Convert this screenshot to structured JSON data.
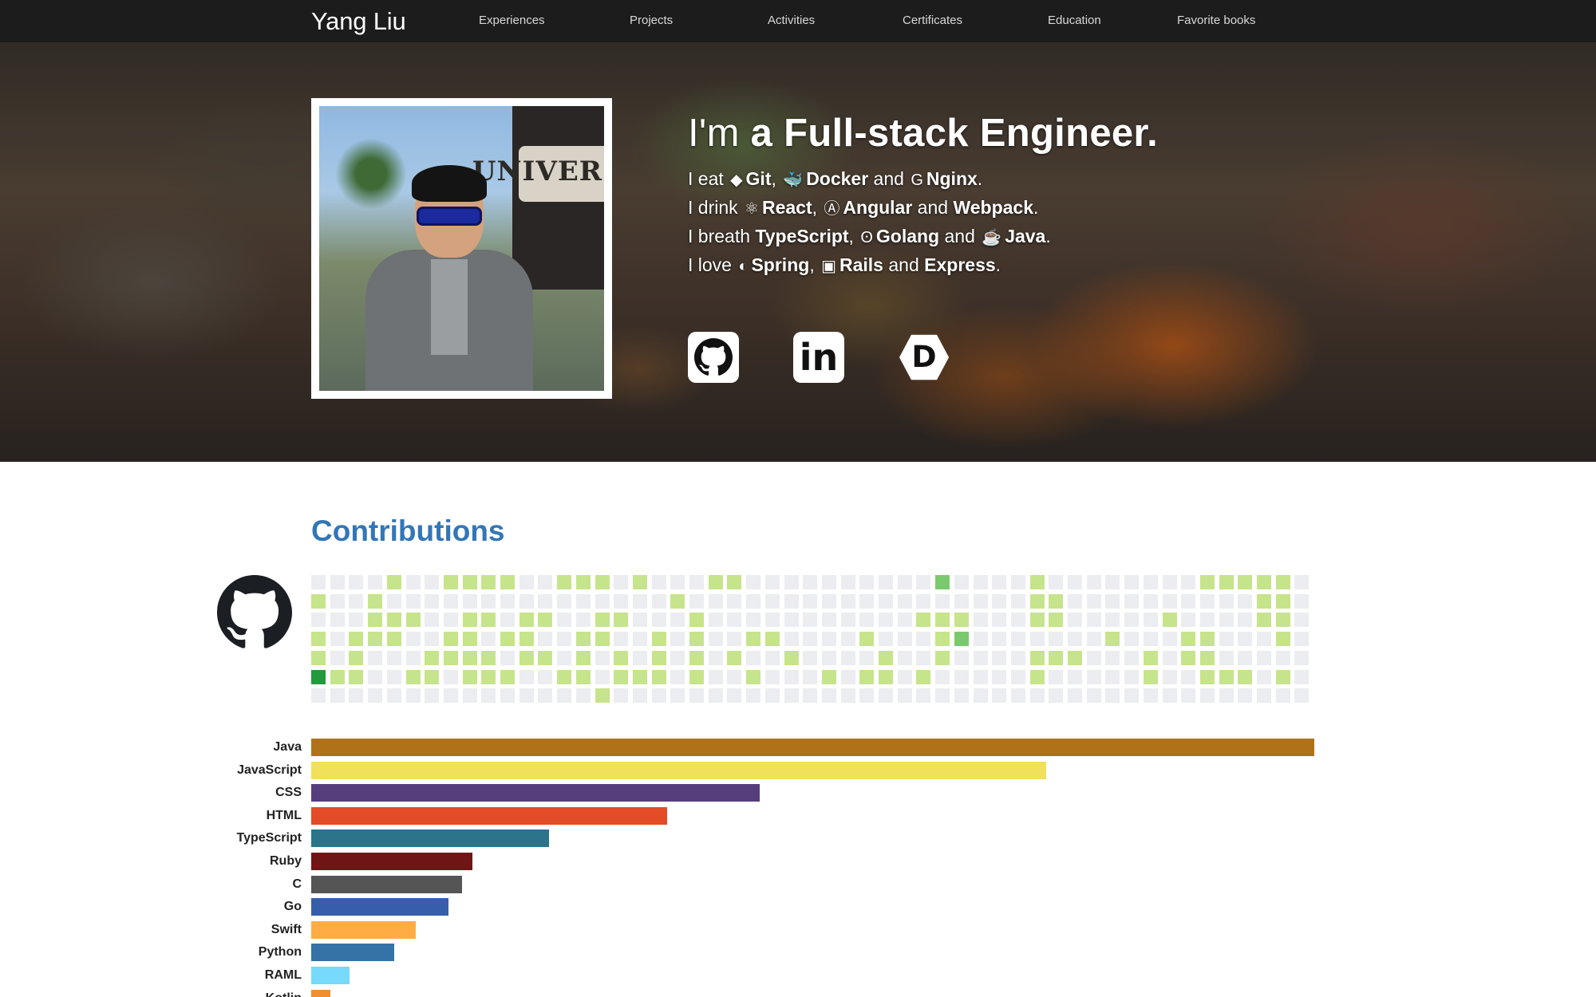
{
  "navbar": {
    "brand": "Yang Liu",
    "links": [
      {
        "label": "Experiences",
        "active": true
      },
      {
        "label": "Projects",
        "active": false
      },
      {
        "label": "Activities",
        "active": false
      },
      {
        "label": "Certificates",
        "active": false
      },
      {
        "label": "Education",
        "active": false
      },
      {
        "label": "Favorite books",
        "active": false
      }
    ]
  },
  "hero": {
    "title_prefix": "I'm",
    "title_a": "a",
    "title_main": "Full-stack Engineer.",
    "lines": [
      {
        "verb": "I eat",
        "items": [
          {
            "icon": "git-icon",
            "glyph": "◆",
            "name": "Git",
            "sep": ","
          },
          {
            "icon": "docker-icon",
            "glyph": "🐳",
            "name": "Docker",
            "sep": " and"
          },
          {
            "icon": "nginx-icon",
            "glyph": "G",
            "name": "Nginx",
            "sep": "."
          }
        ]
      },
      {
        "verb": "I drink",
        "items": [
          {
            "icon": "react-icon",
            "glyph": "⚛",
            "name": "React",
            "sep": ","
          },
          {
            "icon": "angular-icon",
            "glyph": "Ⓐ",
            "name": "Angular",
            "sep": " and"
          },
          {
            "icon": "",
            "glyph": "",
            "name": "Webpack",
            "sep": "."
          }
        ]
      },
      {
        "verb": "I breath",
        "items": [
          {
            "icon": "",
            "glyph": "",
            "name": "TypeScript",
            "sep": ","
          },
          {
            "icon": "gopher-icon",
            "glyph": "ʘ",
            "name": "Golang",
            "sep": " and"
          },
          {
            "icon": "java-icon",
            "glyph": "☕",
            "name": "Java",
            "sep": "."
          }
        ]
      },
      {
        "verb": "I love",
        "items": [
          {
            "icon": "spring-icon",
            "glyph": "◐",
            "name": "Spring",
            "sep": ","
          },
          {
            "icon": "rails-icon",
            "glyph": "▣",
            "name": "Rails",
            "sep": " and"
          },
          {
            "icon": "",
            "glyph": "",
            "name": "Express",
            "sep": "."
          }
        ]
      }
    ],
    "social": [
      {
        "name": "github-icon",
        "glyph": "",
        "kind": "github"
      },
      {
        "name": "linkedin-icon",
        "glyph": "in",
        "kind": "box"
      },
      {
        "name": "dev-icon",
        "glyph": "D",
        "kind": "hex"
      }
    ],
    "photo_sign_text": "UNIVER"
  },
  "contributions": {
    "title": "Contributions",
    "palette": [
      "#ebedf0",
      "#c6e48b",
      "#7bc96f",
      "#239a3b",
      "#196127"
    ],
    "weeks": 53,
    "days": 7,
    "levels": [
      "0000100111100111010001100000000002000010000000011111",
      "1001000000000000000100000000000000000011000000000011",
      "0001110011011001100010000000000011100011000001000011",
      "1011100110110011001010011000010001200000001000110001",
      "1010001111011010101010100100001001000011100010110000",
      "3110011011100110111010010001011010000010000010011101",
      "0000000000000001000000000000000000000000000000000000"
    ]
  },
  "languages": [
    {
      "name": "Java",
      "value": 100,
      "color": "#b07219"
    },
    {
      "name": "JavaScript",
      "value": 73.3,
      "color": "#f1e05a"
    },
    {
      "name": "CSS",
      "value": 44.7,
      "color": "#563d7c"
    },
    {
      "name": "HTML",
      "value": 35.5,
      "color": "#e34c26"
    },
    {
      "name": "TypeScript",
      "value": 23.7,
      "color": "#2b7489"
    },
    {
      "name": "Ruby",
      "value": 16.1,
      "color": "#701516"
    },
    {
      "name": "C",
      "value": 15.0,
      "color": "#555555"
    },
    {
      "name": "Go",
      "value": 13.7,
      "color": "#375eab"
    },
    {
      "name": "Swift",
      "value": 10.4,
      "color": "#ffac45"
    },
    {
      "name": "Python",
      "value": 8.3,
      "color": "#3572A5"
    },
    {
      "name": "RAML",
      "value": 3.8,
      "color": "#77d9fb"
    },
    {
      "name": "Kotlin",
      "value": 1.9,
      "color": "#F18E33"
    }
  ]
}
